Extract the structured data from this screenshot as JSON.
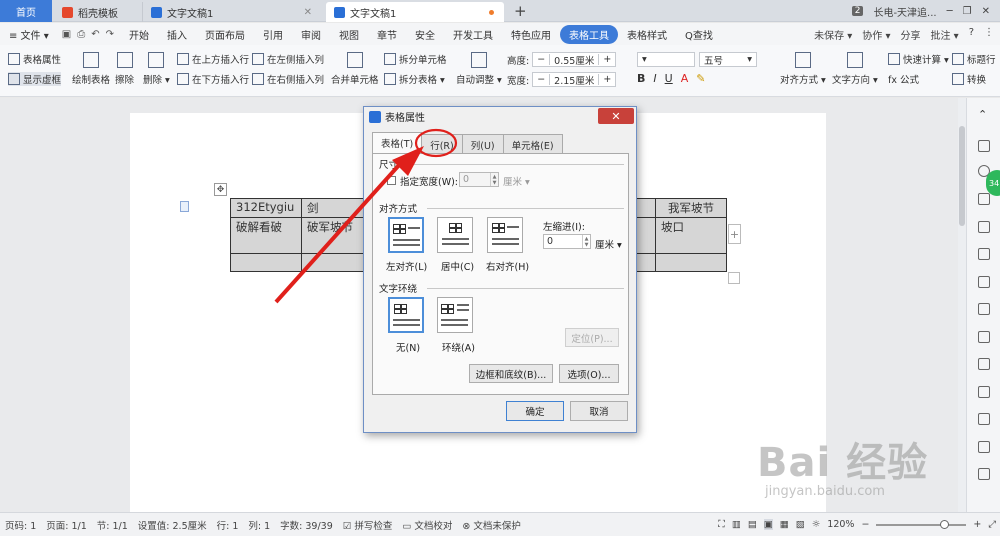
{
  "titlebar": {
    "tabs": [
      {
        "label": "首页"
      },
      {
        "label": "稻壳模板"
      },
      {
        "label": "文字文稿1"
      },
      {
        "label": "文字文稿1"
      }
    ],
    "new_tab": "+",
    "badge": "2",
    "user": "长电-天津追...",
    "window_buttons": [
      "─",
      "❐",
      "✕"
    ]
  },
  "menubar": {
    "file": "≡ 文件 ▾",
    "items": [
      "开始",
      "插入",
      "页面布局",
      "引用",
      "审阅",
      "视图",
      "章节",
      "安全",
      "开发工具",
      "特色应用",
      "表格工具",
      "表格样式"
    ],
    "active": "表格工具",
    "search": "Q查找",
    "right": [
      "未保存 ▾",
      "协作 ▾",
      "分享",
      "批注 ▾",
      "?",
      "⋮"
    ]
  },
  "ribbon": {
    "table_props": "表格属性",
    "show_gridlines": "显示虚框",
    "draw_table": "绘制表格",
    "erase": "擦除",
    "delete": "删除 ▾",
    "insert_above": "在上方插入行",
    "insert_below": "在下方插入行",
    "insert_left": "在左侧插入列",
    "insert_right": "在右侧插入列",
    "merge_cells": "合并单元格",
    "split_cells": "拆分单元格",
    "split_table": "拆分表格 ▾",
    "auto_adjust": "自动调整 ▾",
    "height_label": "高度:",
    "height_value": "0.55厘米",
    "width_label": "宽度:",
    "width_value": "2.15厘米",
    "font_size": "五号",
    "align": "对齐方式 ▾",
    "text_dir": "文字方向 ▾",
    "quick_calc": "快速计算 ▾",
    "title_row": "标题行",
    "formula": "fx 公式",
    "convert": "转换"
  },
  "document": {
    "table": [
      [
        "312Etygiu",
        "剑",
        "",
        "我军坡节"
      ],
      [
        "破解看破",
        "破军坡节",
        "",
        "坡口"
      ],
      [
        "",
        "",
        "",
        ""
      ]
    ]
  },
  "dialog": {
    "title": "表格属性",
    "close": "✕",
    "tabs": [
      "表格(T)",
      "行(R)",
      "列(U)",
      "单元格(E)"
    ],
    "active_tab": "表格(T)",
    "size_section": "尺寸",
    "specify_width": "指定宽度(W):",
    "width_value": "0",
    "width_unit": "厘米 ▾",
    "align_section": "对齐方式",
    "align_options": [
      "左对齐(L)",
      "居中(C)",
      "右对齐(H)"
    ],
    "indent_label": "左缩进(I):",
    "indent_value": "0",
    "indent_unit": "厘米 ▾",
    "wrap_section": "文字环绕",
    "wrap_options": [
      "无(N)",
      "环绕(A)"
    ],
    "position_button": "定位(P)...",
    "borders_button": "边框和底纹(B)...",
    "options_button": "选项(O)...",
    "ok": "确定",
    "cancel": "取消"
  },
  "statusbar": {
    "items": [
      "页码: 1",
      "页面: 1/1",
      "节: 1/1",
      "设置值: 2.5厘米",
      "行: 1",
      "列: 1",
      "字数: 39/39",
      "拼写检查",
      "文档校对",
      "文档未保护"
    ],
    "zoom": "120%",
    "zoom_minus": "−",
    "zoom_plus": "+"
  },
  "watermark": {
    "brand": "Bai 经验",
    "url": "jingyan.baidu.com"
  },
  "colors": {
    "accent": "#3d7bd8",
    "annotation": "#e0201b",
    "close_button": "#c8413a"
  }
}
